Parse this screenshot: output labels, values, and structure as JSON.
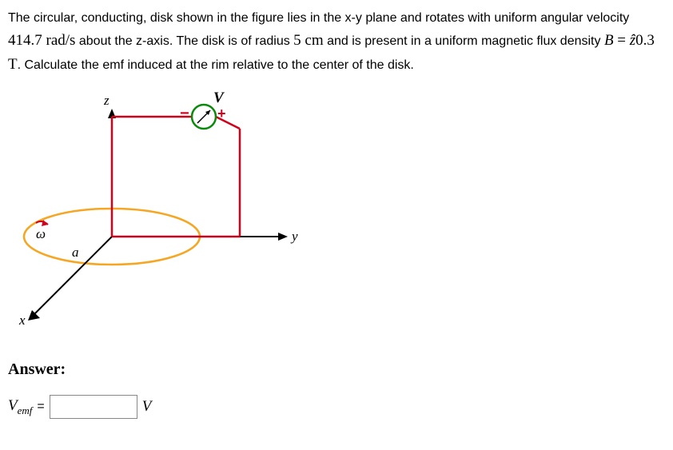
{
  "problem": {
    "text_parts": {
      "p1": "The circular, conducting, disk shown in the figure lies in the x-y plane and rotates with uniform angular velocity ",
      "angular_velocity": "414.7 rad/s",
      "p2": " about the z-axis. The disk is of radius ",
      "radius": "5 cm",
      "p3": " and is present in a uniform magnetic flux density ",
      "B_var": "B",
      "equals": " = ",
      "z_hat": "ẑ",
      "flux_value": "0.3 T",
      "p4": ". Calculate the emf induced at the rim relative to the center of the disk."
    }
  },
  "figure": {
    "labels": {
      "z": "z",
      "V": "V",
      "omega": "ω",
      "a": "a",
      "y": "y",
      "x": "x",
      "plus": "+",
      "minus": "−"
    }
  },
  "answer": {
    "label": "Answer:",
    "variable": "V",
    "subscript": "emf",
    "equals": "=",
    "value": "",
    "unit": "V"
  }
}
